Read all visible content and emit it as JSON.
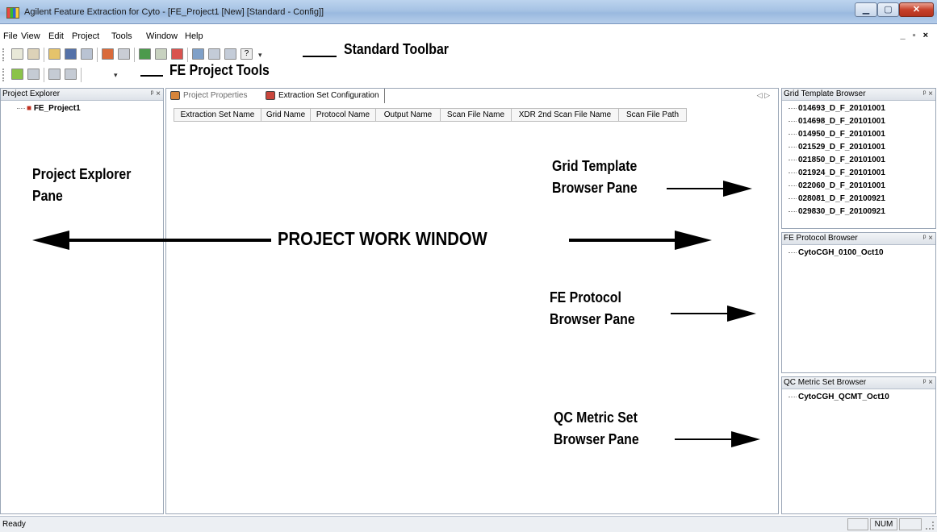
{
  "window": {
    "title": "Agilent Feature Extraction for Cyto - [FE_Project1 [New] [Standard - Config]]"
  },
  "menu": [
    "File",
    "View",
    "Edit",
    "Project",
    "Tools",
    "Window",
    "Help"
  ],
  "mdi_controls": "_ ▫ ×",
  "annotations": {
    "standard_toolbar": "Standard Toolbar",
    "fe_project_tools": "FE Project Tools",
    "project_explorer_pane": [
      "Project Explorer",
      "Pane"
    ],
    "project_work_window": "PROJECT WORK WINDOW",
    "grid_template_browser_pane": [
      "Grid Template",
      "Browser Pane"
    ],
    "fe_protocol_browser_pane": [
      "FE Protocol",
      "Browser Pane"
    ],
    "qc_metric_set_browser_pane": [
      "QC Metric Set",
      "Browser Pane"
    ]
  },
  "project_explorer": {
    "title": "Project Explorer",
    "items": [
      "FE_Project1"
    ]
  },
  "work_window": {
    "tabs": [
      "Project Properties",
      "Extraction Set Configuration"
    ],
    "columns": [
      "Extraction Set Name",
      "Grid Name",
      "Protocol Name",
      "Output Name",
      "Scan File Name",
      "XDR 2nd Scan File Name",
      "Scan File Path"
    ]
  },
  "grid_template_browser": {
    "title": "Grid Template Browser",
    "items": [
      "014693_D_F_20101001",
      "014698_D_F_20101001",
      "014950_D_F_20101001",
      "021529_D_F_20101001",
      "021850_D_F_20101001",
      "021924_D_F_20101001",
      "022060_D_F_20101001",
      "028081_D_F_20100921",
      "029830_D_F_20100921"
    ]
  },
  "fe_protocol_browser": {
    "title": "FE Protocol Browser",
    "items": [
      "CytoCGH_0100_Oct10"
    ]
  },
  "qc_metric_set_browser": {
    "title": "QC Metric Set Browser",
    "items": [
      "CytoCGH_QCMT_Oct10"
    ]
  },
  "pane_controls": "ᵖ ×",
  "status": {
    "text": "Ready",
    "num": "NUM"
  }
}
